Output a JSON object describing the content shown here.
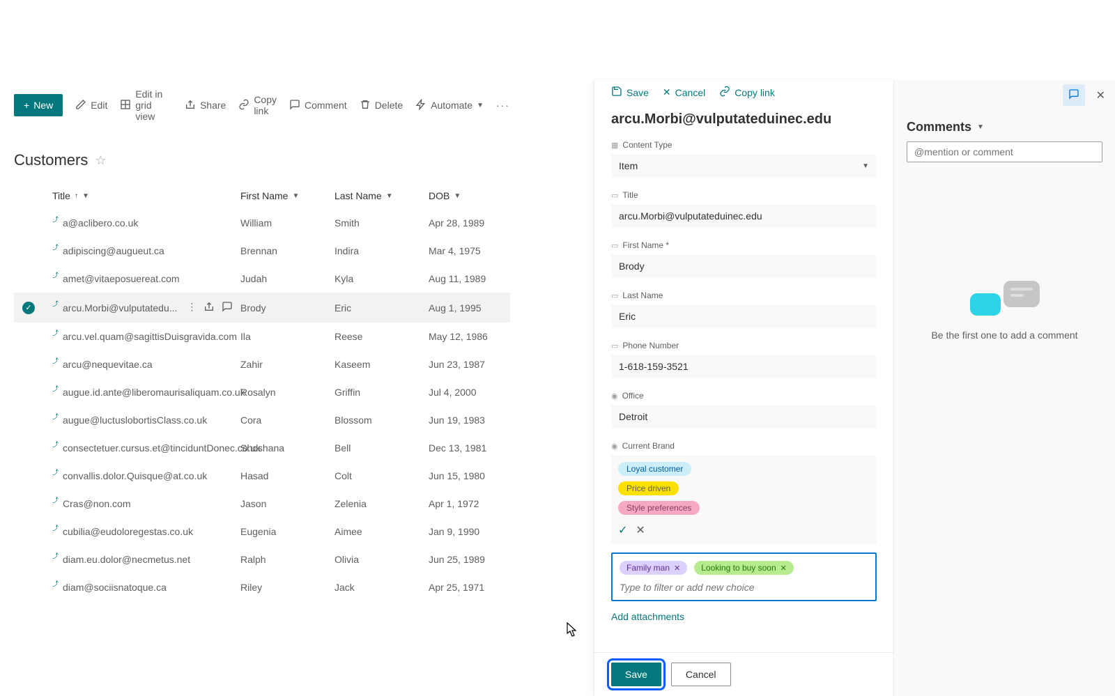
{
  "toolbar": {
    "new": "New",
    "edit": "Edit",
    "edit_grid": "Edit in grid view",
    "share": "Share",
    "copy_link": "Copy link",
    "comment": "Comment",
    "delete": "Delete",
    "automate": "Automate"
  },
  "list": {
    "title": "Customers",
    "columns": {
      "title": "Title",
      "first_name": "First Name",
      "last_name": "Last Name",
      "dob": "DOB"
    },
    "rows": [
      {
        "title": "a@aclibero.co.uk",
        "first_name": "William",
        "last_name": "Smith",
        "dob": "Apr 28, 1989"
      },
      {
        "title": "adipiscing@augueut.ca",
        "first_name": "Brennan",
        "last_name": "Indira",
        "dob": "Mar 4, 1975"
      },
      {
        "title": "amet@vitaeposuereat.com",
        "first_name": "Judah",
        "last_name": "Kyla",
        "dob": "Aug 11, 1989"
      },
      {
        "title": "arcu.Morbi@vulputatedu...",
        "first_name": "Brody",
        "last_name": "Eric",
        "dob": "Aug 1, 1995",
        "selected": true
      },
      {
        "title": "arcu.vel.quam@sagittisDuisgravida.com",
        "first_name": "Ila",
        "last_name": "Reese",
        "dob": "May 12, 1986"
      },
      {
        "title": "arcu@nequevitae.ca",
        "first_name": "Zahir",
        "last_name": "Kaseem",
        "dob": "Jun 23, 1987"
      },
      {
        "title": "augue.id.ante@liberomaurisaliquam.co.uk",
        "first_name": "Rosalyn",
        "last_name": "Griffin",
        "dob": "Jul 4, 2000"
      },
      {
        "title": "augue@luctuslobortisClass.co.uk",
        "first_name": "Cora",
        "last_name": "Blossom",
        "dob": "Jun 19, 1983"
      },
      {
        "title": "consectetuer.cursus.et@tinciduntDonec.co.uk",
        "first_name": "Shoshana",
        "last_name": "Bell",
        "dob": "Dec 13, 1981"
      },
      {
        "title": "convallis.dolor.Quisque@at.co.uk",
        "first_name": "Hasad",
        "last_name": "Colt",
        "dob": "Jun 15, 1980"
      },
      {
        "title": "Cras@non.com",
        "first_name": "Jason",
        "last_name": "Zelenia",
        "dob": "Apr 1, 1972"
      },
      {
        "title": "cubilia@eudoloregestas.co.uk",
        "first_name": "Eugenia",
        "last_name": "Aimee",
        "dob": "Jan 9, 1990"
      },
      {
        "title": "diam.eu.dolor@necmetus.net",
        "first_name": "Ralph",
        "last_name": "Olivia",
        "dob": "Jun 25, 1989"
      },
      {
        "title": "diam@sociisnatoque.ca",
        "first_name": "Riley",
        "last_name": "Jack",
        "dob": "Apr 25, 1971"
      }
    ]
  },
  "panel": {
    "toolbar": {
      "save": "Save",
      "cancel": "Cancel",
      "copy_link": "Copy link"
    },
    "title": "arcu.Morbi@vulputateduinec.edu",
    "fields": {
      "content_type": {
        "label": "Content Type",
        "value": "Item"
      },
      "title": {
        "label": "Title",
        "value": "arcu.Morbi@vulputateduinec.edu"
      },
      "first_name": {
        "label": "First Name *",
        "value": "Brody"
      },
      "last_name": {
        "label": "Last Name",
        "value": "Eric"
      },
      "phone": {
        "label": "Phone Number",
        "value": "1-618-159-3521"
      },
      "office": {
        "label": "Office",
        "value": "Detroit"
      },
      "current_brand": {
        "label": "Current Brand"
      }
    },
    "choice_options": [
      {
        "label": "Loyal customer",
        "class": "pill-blue"
      },
      {
        "label": "Price driven",
        "class": "pill-yellow"
      },
      {
        "label": "Style preferences",
        "class": "pill-pink"
      }
    ],
    "selected_choices": [
      {
        "label": "Family man",
        "class": "pill-purple"
      },
      {
        "label": "Looking to buy soon",
        "class": "pill-green"
      }
    ],
    "choice_input_placeholder": "Type to filter or add new choice",
    "add_attachments": "Add attachments",
    "footer": {
      "save": "Save",
      "cancel": "Cancel"
    }
  },
  "comments": {
    "title": "Comments",
    "input_placeholder": "@mention or comment",
    "empty_text": "Be the first one to add a comment"
  }
}
